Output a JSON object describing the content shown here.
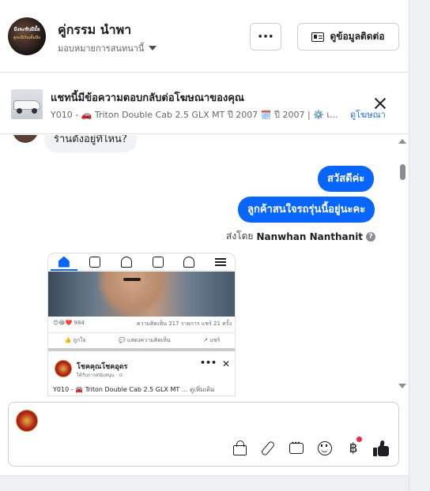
{
  "header": {
    "page_name": "คู่กรรม นำพา",
    "avatar_text_1": "มีงจะขับมีมั้ย",
    "avatar_text_2": "ตูจะมีเงินเต็มมือ",
    "assign_label": "มอบหมายการสนทนานี้",
    "more_label": "···",
    "contact_label": "ดูข้อมูลติดต่อ"
  },
  "ad_banner": {
    "title": "แชทนี้มีข้อความตอบกลับต่อโฆษณาของคุณ",
    "description": "Y010 - 🚗 Triton Double Cab 2.5 GLX MT ปี 2007 🗓️ ปี 2007 | ⚙️ เ...",
    "view_ad_label": "ดูโฆษณา"
  },
  "messages": {
    "incoming_partial": "ร้านตั้งอยู่ที่ไหน?",
    "outgoing": [
      "สวัสดีค่ะ",
      "ลูกค้าสนใจรถรุ่นนี้อยู่นะคะ"
    ],
    "sent_by_label": "ส่งโดย",
    "sent_by_name": "Nanwhan Nanthanit",
    "help_mark": "?"
  },
  "attachment": {
    "reactions": "😊😂❤️ 984",
    "stats": "ความคิดเห็น 217 รายการ  แชร์ 21 ครั้ง",
    "actions": [
      "👍 ถูกใจ",
      "💬 แสดงความคิดเห็น",
      "↗ แชร์"
    ],
    "post_name": "โชคคุณโชคอุดร",
    "post_sub": "ได้รับการสนับสนุน · ⊙",
    "post_dots": "•••",
    "post_close": "✕",
    "post_text": "Y010 - 🚘 Triton Double Cab 2.5 GLX MT",
    "post_more": "... ดูเพิ่มเติม"
  },
  "composer": {
    "placeholder": ""
  },
  "icons": [
    "bag-icon",
    "paperclip-icon",
    "chat-bubble-icon",
    "smile-icon",
    "baht-icon",
    "thumbs-up-icon"
  ],
  "colors": {
    "accent": "#0866ff",
    "link": "#216fdb",
    "notification": "#f02849"
  }
}
